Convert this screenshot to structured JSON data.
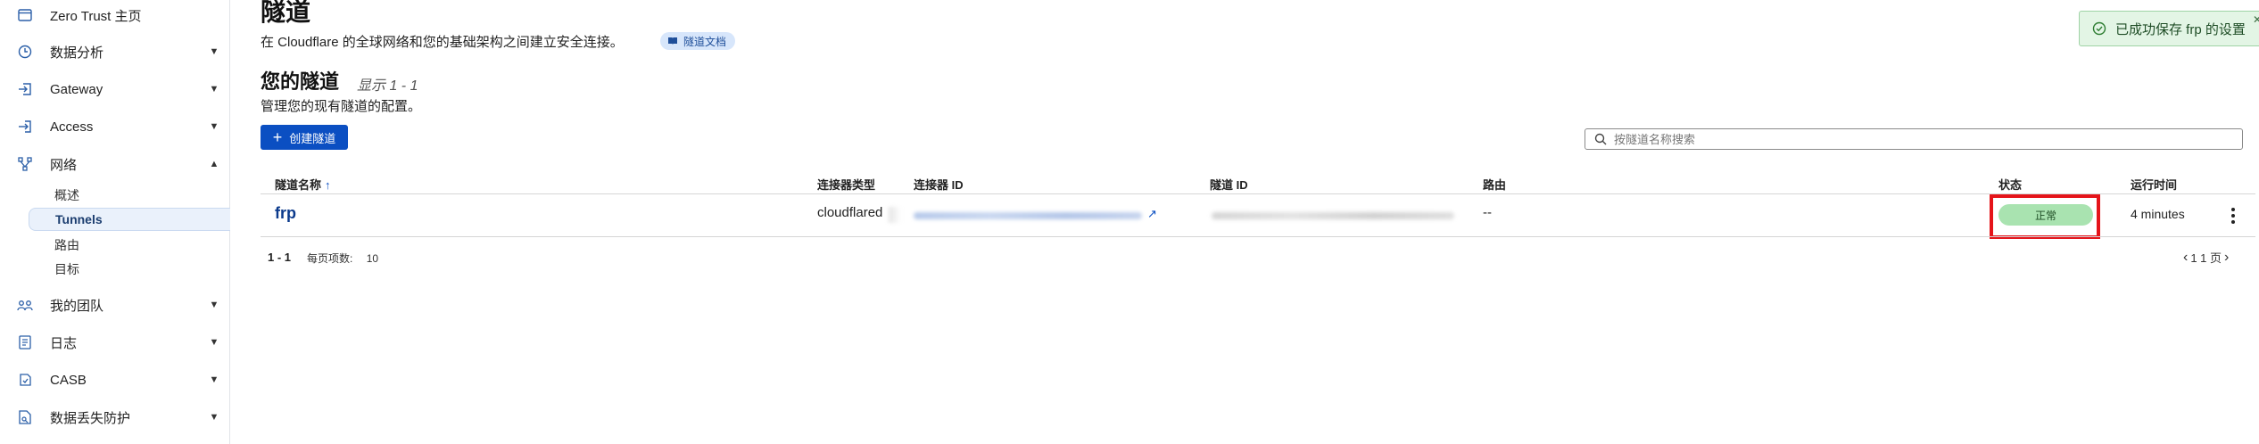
{
  "sidebar": {
    "items": [
      {
        "label": "Zero Trust 主页",
        "icon": "home-page-icon"
      },
      {
        "label": "数据分析",
        "icon": "analytics-clock-icon"
      },
      {
        "label": "Gateway",
        "icon": "gateway-arrow-icon"
      },
      {
        "label": "Access",
        "icon": "access-login-icon"
      },
      {
        "label": "网络",
        "icon": "network-nodes-icon"
      },
      {
        "label": "我的团队",
        "icon": "team-users-icon"
      },
      {
        "label": "日志",
        "icon": "logs-document-icon"
      },
      {
        "label": "CASB",
        "icon": "casb-shield-icon"
      },
      {
        "label": "数据丢失防护",
        "icon": "dlp-document-icon"
      }
    ],
    "network_subitems": [
      {
        "label": "概述"
      },
      {
        "label": "Tunnels"
      },
      {
        "label": "路由"
      },
      {
        "label": "目标"
      }
    ]
  },
  "header": {
    "title": "隧道",
    "description": "在 Cloudflare 的全球网络和您的基础架构之间建立安全连接。",
    "doc_badge": "隧道文档"
  },
  "section": {
    "title": "您的隧道",
    "count_text": "显示 1 - 1",
    "subtitle": "管理您的现有隧道的配置。"
  },
  "actions": {
    "create_label": "创建隧道"
  },
  "search": {
    "placeholder": "按隧道名称搜索"
  },
  "table": {
    "columns": [
      "隧道名称",
      "连接器类型",
      "连接器 ID",
      "隧道 ID",
      "路由",
      "状态",
      "运行时间"
    ],
    "sort_indicator": "↑",
    "rows": [
      {
        "name": "frp",
        "connector_type": "cloudflared",
        "route": "--",
        "status": "正常",
        "uptime": "4 minutes"
      }
    ]
  },
  "footer": {
    "range": "1 - 1",
    "per_page_label": "每页项数:",
    "per_page_value": "10",
    "page_text": "1 1 页"
  },
  "toast": {
    "message": "已成功保存 frp 的设置"
  },
  "colors": {
    "accent": "#0b4fc2",
    "status_green": "#a9e3b0",
    "highlight_red": "#e5141a",
    "toast_bg": "#e3f5e5"
  }
}
